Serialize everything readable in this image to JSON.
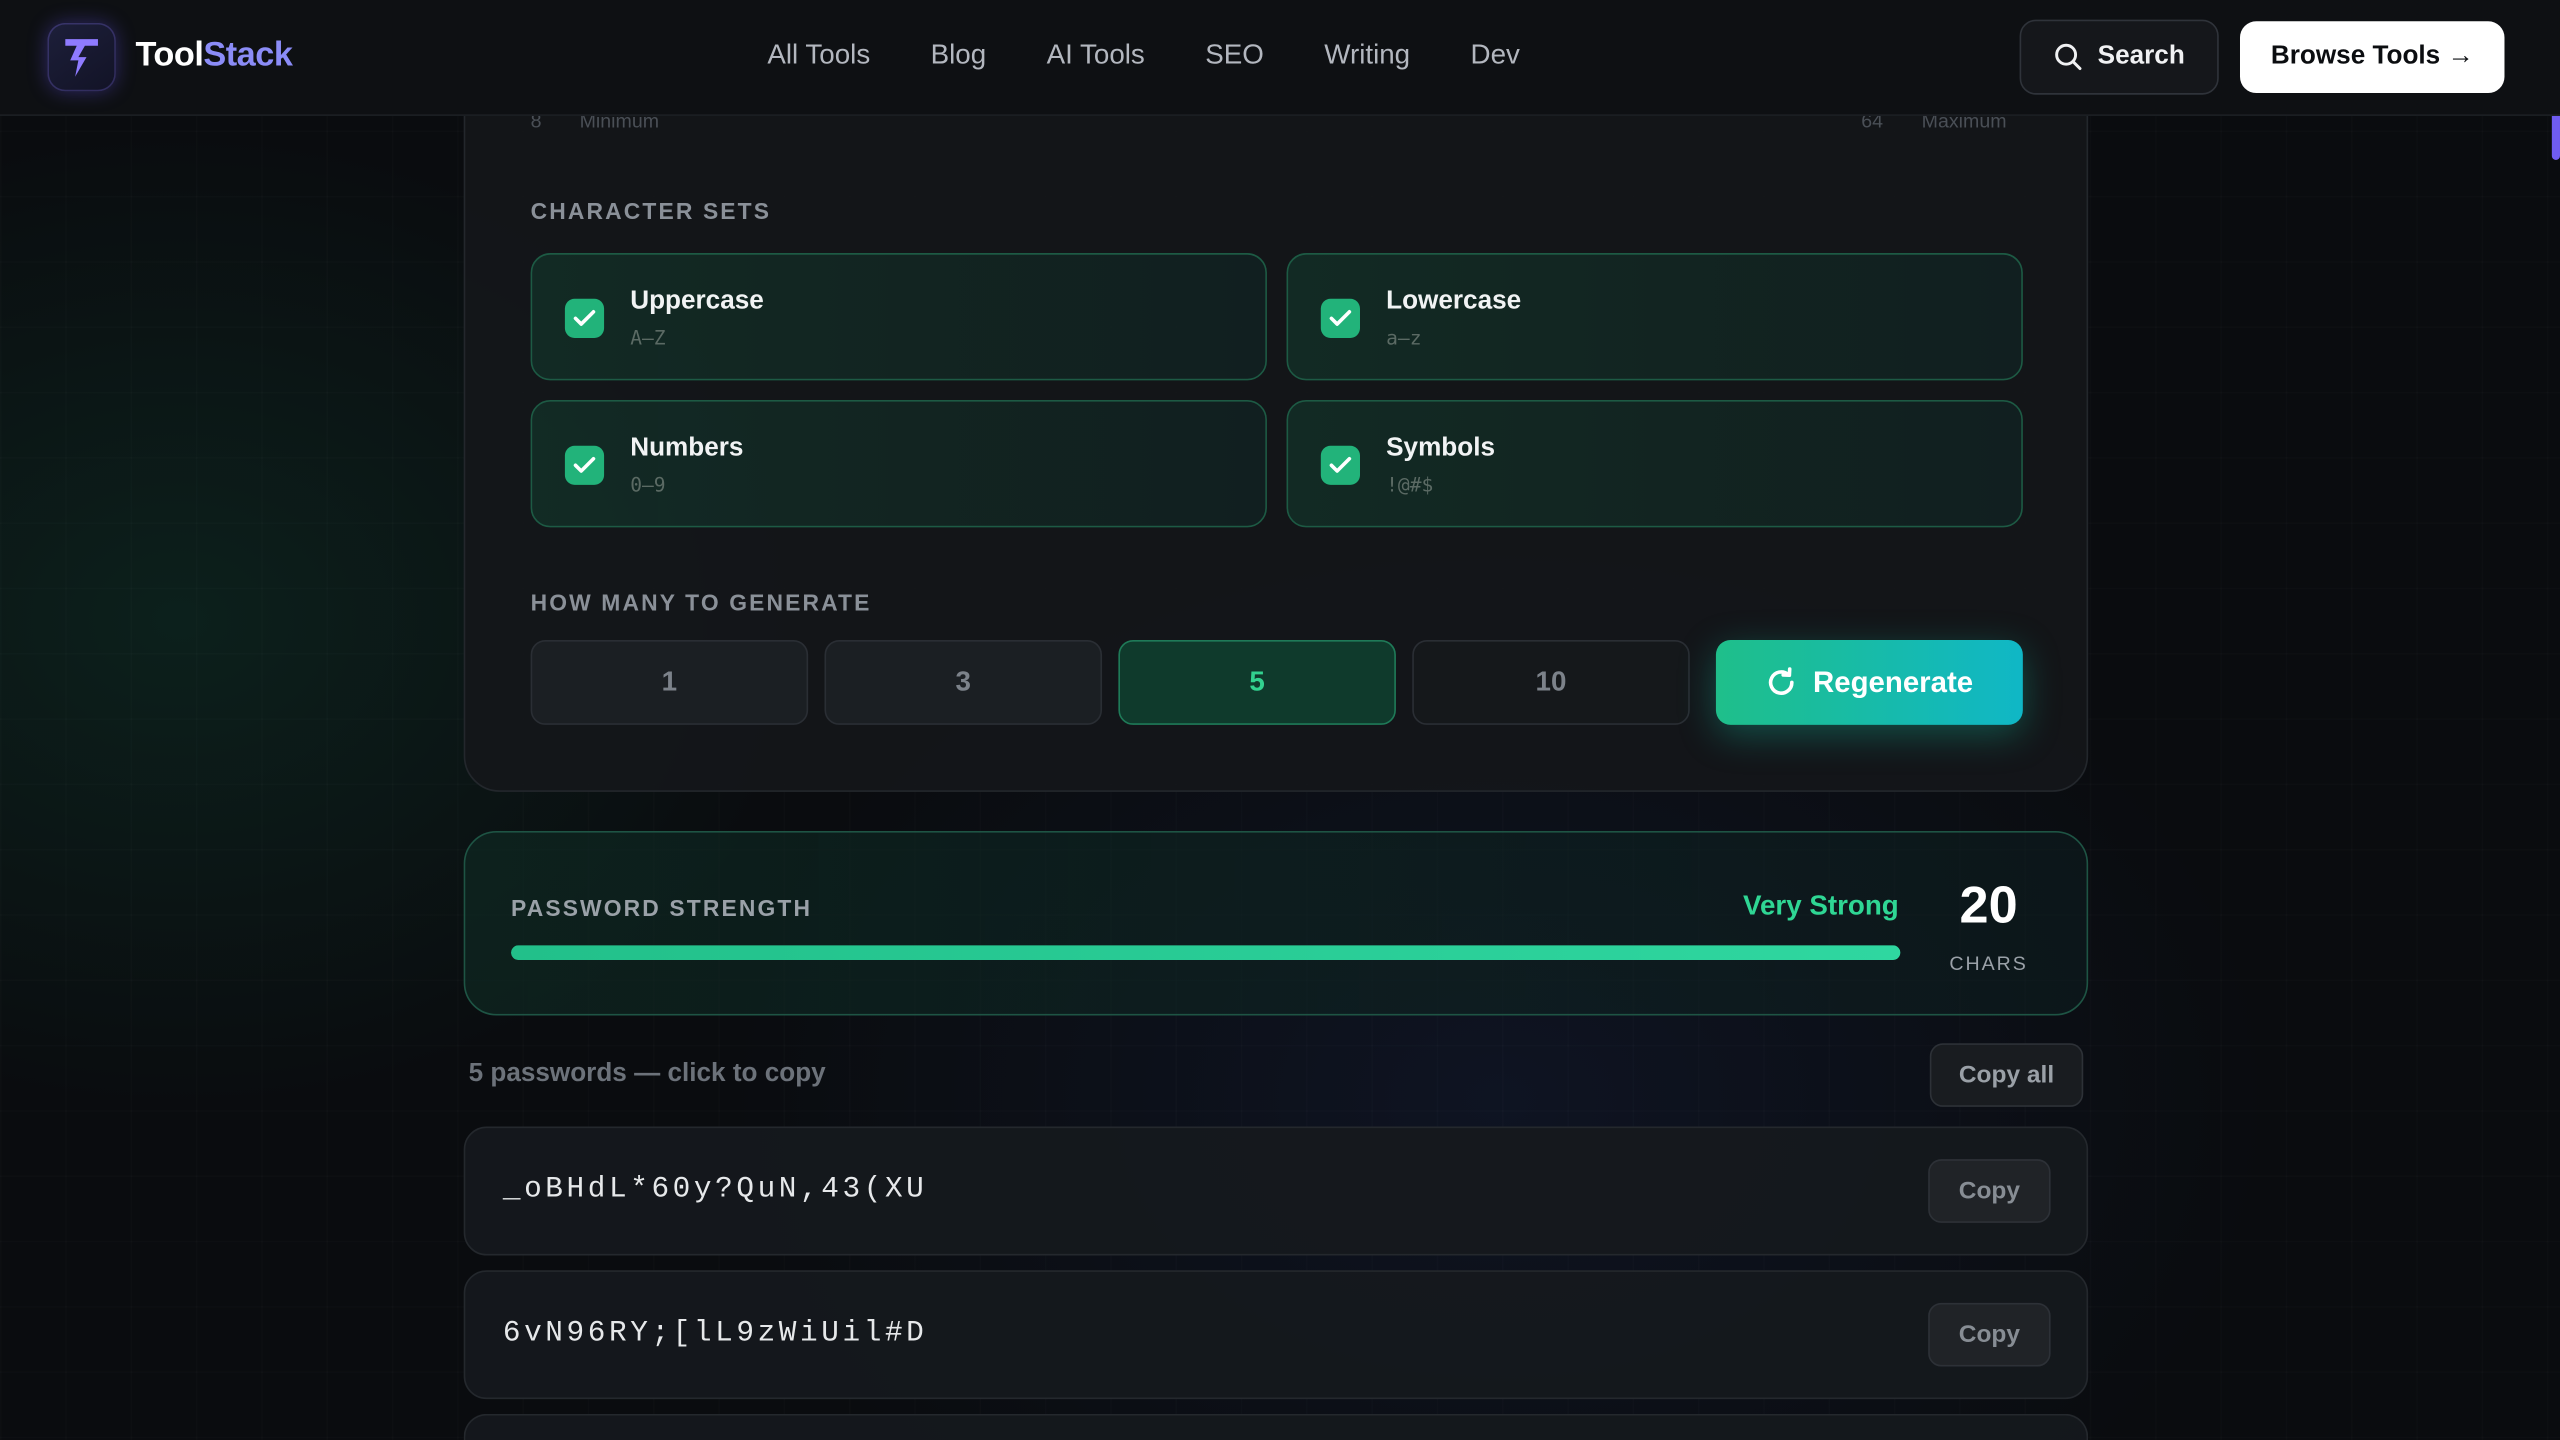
{
  "header": {
    "brand_part1": "Tool",
    "brand_part2": "Stack",
    "nav": [
      "All Tools",
      "Blog",
      "AI Tools",
      "SEO",
      "Writing",
      "Dev"
    ],
    "search_label": "Search",
    "browse_label": "Browse Tools →"
  },
  "length_slider": {
    "min_value": "8",
    "min_label": "Minimum",
    "max_value": "64",
    "max_label": "Maximum"
  },
  "character_sets": {
    "label": "CHARACTER SETS",
    "options": [
      {
        "title": "Uppercase",
        "sample": "A–Z",
        "checked": true
      },
      {
        "title": "Lowercase",
        "sample": "a–z",
        "checked": true
      },
      {
        "title": "Numbers",
        "sample": "0–9",
        "checked": true
      },
      {
        "title": "Symbols",
        "sample": "!@#$",
        "checked": true
      }
    ]
  },
  "generate": {
    "label": "HOW MANY TO GENERATE",
    "counts": [
      "1",
      "3",
      "5",
      "10"
    ],
    "selected": "5",
    "regenerate_label": "Regenerate"
  },
  "strength": {
    "label": "PASSWORD STRENGTH",
    "rating": "Very Strong",
    "percent": 100,
    "length": "20",
    "length_unit": "CHARS"
  },
  "passwords": {
    "caption": "5 passwords — click to copy",
    "copy_all_label": "Copy all",
    "copy_label": "Copy",
    "items": [
      "_oBHdL*60y?QuN,43(XU",
      "6vN96RY;[lL9zWiUil#D"
    ]
  },
  "colors": {
    "accent_green": "#2fd694",
    "brand_purple": "#8b8cf7",
    "regenerate_gradient_start": "#1fbf8a",
    "regenerate_gradient_end": "#10b7c6"
  }
}
